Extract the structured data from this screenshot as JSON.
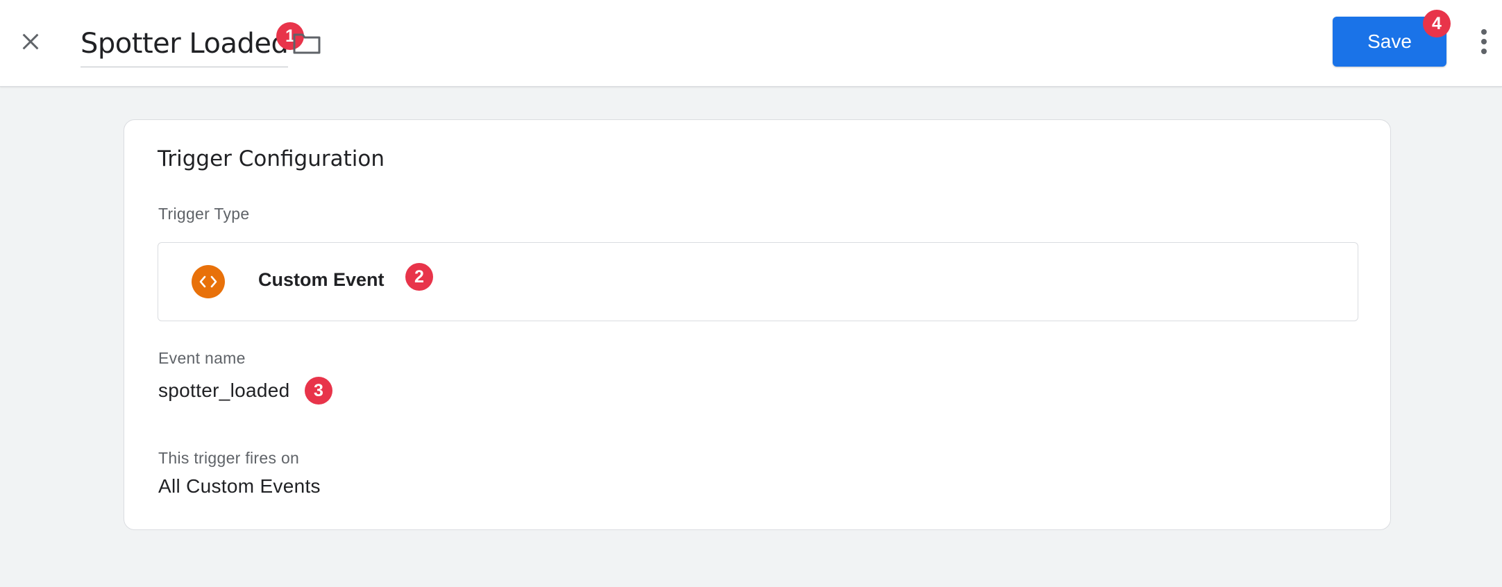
{
  "header": {
    "title": "Spotter Loaded",
    "save_label": "Save",
    "close_icon": "close-icon",
    "folder_icon": "folder-icon",
    "more_icon": "more-vert-icon"
  },
  "annotations": {
    "badge_1": "1",
    "badge_2": "2",
    "badge_3": "3",
    "badge_4": "4"
  },
  "card": {
    "title": "Trigger Configuration",
    "trigger_type_label": "Trigger Type",
    "trigger_type": {
      "name": "Custom Event",
      "icon": "code-brackets-icon"
    },
    "event_name_label": "Event name",
    "event_name_value": "spotter_loaded",
    "fires_on_label": "This trigger fires on",
    "fires_on_value": "All Custom Events"
  },
  "colors": {
    "accent": "#1a73e8",
    "badge": "#e8344a",
    "trigger_icon_bg": "#e8710a",
    "page_bg": "#f1f3f4"
  }
}
